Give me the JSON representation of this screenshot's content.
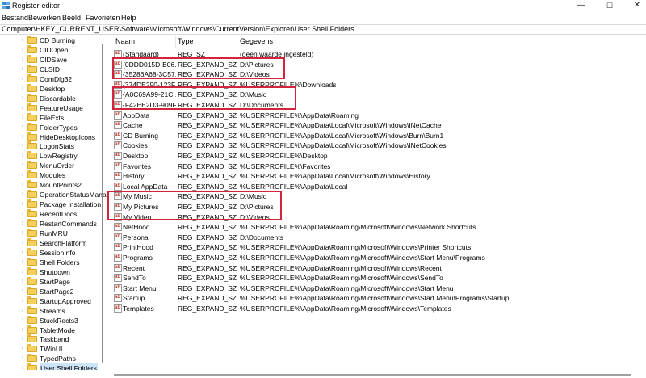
{
  "window": {
    "title": "Register-editor",
    "minimize": "—",
    "maximize": "☐",
    "close": "✕"
  },
  "menu": [
    "Bestand",
    "Bewerken",
    "Beeld",
    "Favorieten",
    "Help"
  ],
  "address": "Computer\\HKEY_CURRENT_USER\\Software\\Microsoft\\Windows\\CurrentVersion\\Explorer\\User Shell Folders",
  "tree": [
    "CD Burning",
    "CIDOpen",
    "CIDSave",
    "CLSID",
    "ComDlg32",
    "Desktop",
    "Discardable",
    "FeatureUsage",
    "FileExts",
    "FolderTypes",
    "HideDesktopIcons",
    "LogonStats",
    "LowRegistry",
    "MenuOrder",
    "Modules",
    "MountPoints2",
    "OperationStatusMana",
    "Package Installation",
    "RecentDocs",
    "RestartCommands",
    "RunMRU",
    "SearchPlatform",
    "SessionInfo",
    "Shell Folders",
    "Shutdown",
    "StartPage",
    "StartPage2",
    "StartupApproved",
    "Streams",
    "StuckRects3",
    "TabletMode",
    "Taskband",
    "TWinUI",
    "TypedPaths",
    "User Shell Folders"
  ],
  "tree_selected": "User Shell Folders",
  "columns": {
    "name": "Naam",
    "type": "Type",
    "data": "Gegevens"
  },
  "rows": [
    {
      "name": "(Standaard)",
      "type": "REG_SZ",
      "data": "(geen waarde ingesteld)"
    },
    {
      "name": "{0DDD015D-B06...",
      "type": "REG_EXPAND_SZ",
      "data": "D:\\Pictures"
    },
    {
      "name": "{35286A68-3C57...",
      "type": "REG_EXPAND_SZ",
      "data": "D:\\Videos"
    },
    {
      "name": "{374DE290-123F...",
      "type": "REG_EXPAND_SZ",
      "data": "%USERPROFILE%\\Downloads"
    },
    {
      "name": "{A0C69A99-21C...",
      "type": "REG_EXPAND_SZ",
      "data": "D:\\Music"
    },
    {
      "name": "{F42EE2D3-909F...",
      "type": "REG_EXPAND_SZ",
      "data": "D:\\Documents"
    },
    {
      "name": "AppData",
      "type": "REG_EXPAND_SZ",
      "data": "%USERPROFILE%\\AppData\\Roaming"
    },
    {
      "name": "Cache",
      "type": "REG_EXPAND_SZ",
      "data": "%USERPROFILE%\\AppData\\Local\\Microsoft\\Windows\\INetCache"
    },
    {
      "name": "CD Burning",
      "type": "REG_EXPAND_SZ",
      "data": "%USERPROFILE%\\AppData\\Local\\Microsoft\\Windows\\Burn\\Burn1"
    },
    {
      "name": "Cookies",
      "type": "REG_EXPAND_SZ",
      "data": "%USERPROFILE%\\AppData\\Local\\Microsoft\\Windows\\INetCookies"
    },
    {
      "name": "Desktop",
      "type": "REG_EXPAND_SZ",
      "data": "%USERPROFILE%\\Desktop"
    },
    {
      "name": "Favorites",
      "type": "REG_EXPAND_SZ",
      "data": "%USERPROFILE%\\Favorites"
    },
    {
      "name": "History",
      "type": "REG_EXPAND_SZ",
      "data": "%USERPROFILE%\\AppData\\Local\\Microsoft\\Windows\\History"
    },
    {
      "name": "Local AppData",
      "type": "REG_EXPAND_SZ",
      "data": "%USERPROFILE%\\AppData\\Local"
    },
    {
      "name": "My Music",
      "type": "REG_EXPAND_SZ",
      "data": "D:\\Music"
    },
    {
      "name": "My Pictures",
      "type": "REG_EXPAND_SZ",
      "data": "D:\\Pictures"
    },
    {
      "name": "My Video",
      "type": "REG_EXPAND_SZ",
      "data": "D:\\Videos"
    },
    {
      "name": "NetHood",
      "type": "REG_EXPAND_SZ",
      "data": "%USERPROFILE%\\AppData\\Roaming\\Microsoft\\Windows\\Network Shortcuts"
    },
    {
      "name": "Personal",
      "type": "REG_EXPAND_SZ",
      "data": "D:\\Documents"
    },
    {
      "name": "PrintHood",
      "type": "REG_EXPAND_SZ",
      "data": "%USERPROFILE%\\AppData\\Roaming\\Microsoft\\Windows\\Printer Shortcuts"
    },
    {
      "name": "Programs",
      "type": "REG_EXPAND_SZ",
      "data": "%USERPROFILE%\\AppData\\Roaming\\Microsoft\\Windows\\Start Menu\\Programs"
    },
    {
      "name": "Recent",
      "type": "REG_EXPAND_SZ",
      "data": "%USERPROFILE%\\AppData\\Roaming\\Microsoft\\Windows\\Recent"
    },
    {
      "name": "SendTo",
      "type": "REG_EXPAND_SZ",
      "data": "%USERPROFILE%\\AppData\\Roaming\\Microsoft\\Windows\\SendTo"
    },
    {
      "name": "Start Menu",
      "type": "REG_EXPAND_SZ",
      "data": "%USERPROFILE%\\AppData\\Roaming\\Microsoft\\Windows\\Start Menu"
    },
    {
      "name": "Startup",
      "type": "REG_EXPAND_SZ",
      "data": "%USERPROFILE%\\AppData\\Roaming\\Microsoft\\Windows\\Start Menu\\Programs\\Startup"
    },
    {
      "name": "Templates",
      "type": "REG_EXPAND_SZ",
      "data": "%USERPROFILE%\\AppData\\Roaming\\Microsoft\\Windows\\Templates"
    }
  ],
  "value_icon": "string-value-icon",
  "highlight_color": "#d4233a"
}
